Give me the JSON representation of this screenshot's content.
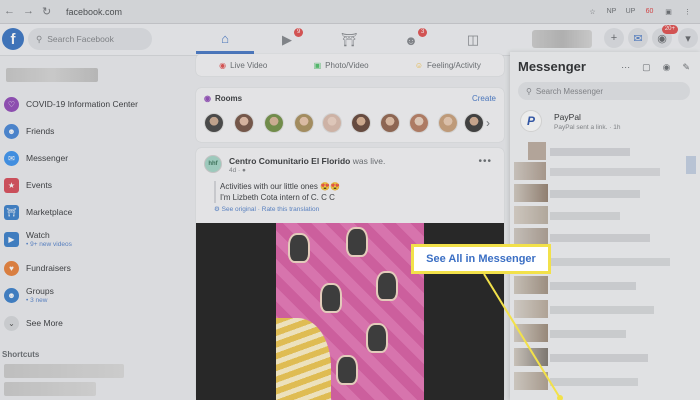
{
  "browser": {
    "url": "facebook.com",
    "extensions": [
      "NP",
      "UP",
      "60"
    ]
  },
  "topbar": {
    "search_placeholder": "Search Facebook",
    "tab_badges": {
      "watch": "9",
      "groups": "3"
    },
    "notification_badge": "20+"
  },
  "sidebar": {
    "items": [
      {
        "label": "COVID-19 Information Center",
        "sub": ""
      },
      {
        "label": "Friends",
        "sub": ""
      },
      {
        "label": "Messenger",
        "sub": ""
      },
      {
        "label": "Events",
        "sub": ""
      },
      {
        "label": "Marketplace",
        "sub": ""
      },
      {
        "label": "Watch",
        "sub": "• 9+ new videos"
      },
      {
        "label": "Fundraisers",
        "sub": ""
      },
      {
        "label": "Groups",
        "sub": "• 3 new"
      },
      {
        "label": "See More",
        "sub": ""
      }
    ],
    "shortcuts_label": "Shortcuts"
  },
  "composer": {
    "live": "Live Video",
    "photo": "Photo/Video",
    "feeling": "Feeling/Activity"
  },
  "rooms": {
    "title": "Rooms",
    "create": "Create"
  },
  "post": {
    "avatar_text": "hhf",
    "author": "Centro Comunitario El Florido",
    "action": "was live.",
    "meta": "4d · ●",
    "line1": "Activities with our little ones 😍😍",
    "line2": "I'm Lizbeth Cota intern of C. C C",
    "see_original": "See original · Rate this translation"
  },
  "messenger": {
    "title": "Messenger",
    "search_placeholder": "Search Messenger",
    "paypal_name": "PayPal",
    "paypal_preview": "PayPal sent a link. · 1h"
  },
  "callout": {
    "label": "See All in Messenger"
  },
  "colors": {
    "accent": "#3b6fc4",
    "callout_border": "#f2e14a"
  }
}
